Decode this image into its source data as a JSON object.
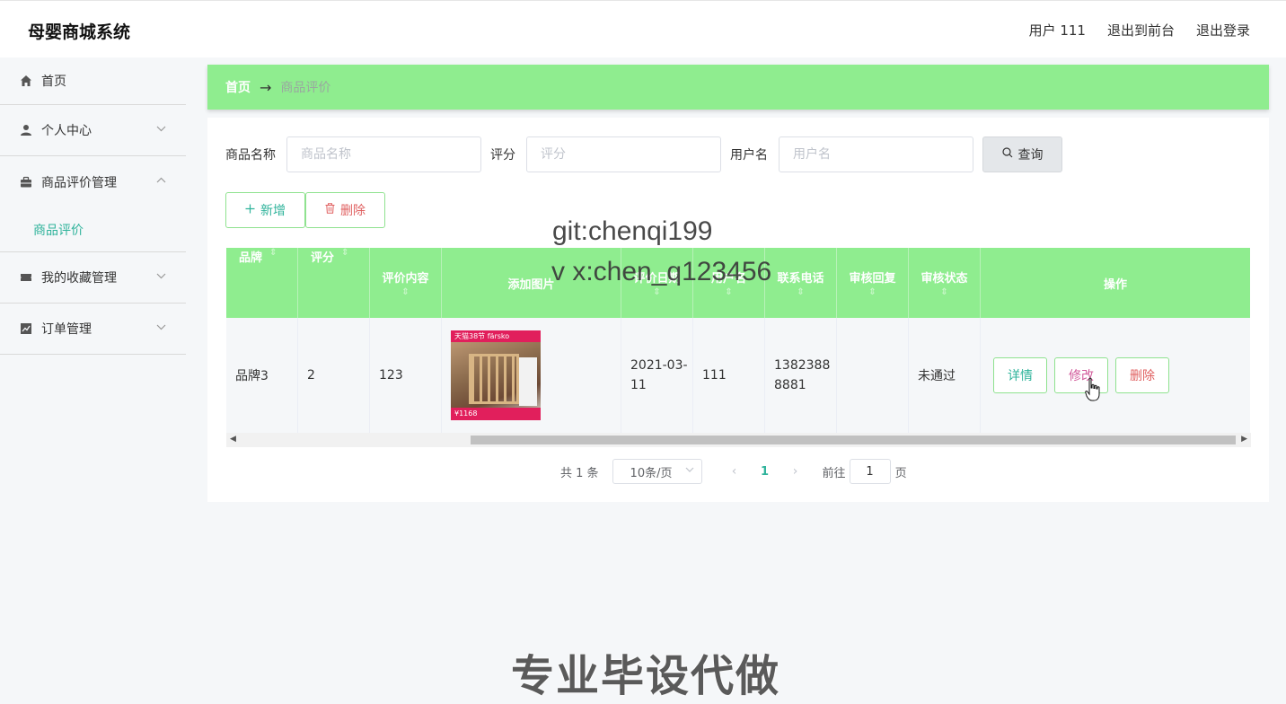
{
  "app": {
    "title": "母婴商城系统"
  },
  "header": {
    "user": "用户 111",
    "to_front": "退出到前台",
    "logout": "退出登录"
  },
  "sidebar": {
    "items": [
      {
        "label": "首页",
        "icon": "home-icon"
      },
      {
        "label": "个人中心",
        "icon": "user-icon"
      },
      {
        "label": "商品评价管理",
        "icon": "briefcase-icon"
      },
      {
        "label": "商品评价",
        "icon": ""
      },
      {
        "label": "我的收藏管理",
        "icon": "ticket-icon"
      },
      {
        "label": "订单管理",
        "icon": "chart-icon"
      }
    ]
  },
  "breadcrumb": {
    "home": "首页",
    "arrow": "→",
    "current": "商品评价"
  },
  "search": {
    "product_label": "商品名称",
    "product_placeholder": "商品名称",
    "product_value": "",
    "score_label": "评分",
    "score_placeholder": "评分",
    "score_value": "",
    "user_label": "用户名",
    "user_placeholder": "用户名",
    "user_value": "",
    "query_label": "查询"
  },
  "actions": {
    "add_label": "新增",
    "delete_label": "删除"
  },
  "table": {
    "headers": [
      "品牌",
      "评分",
      "评价内容",
      "添加图片",
      "评价日期",
      "用户名",
      "联系电话",
      "审核回复",
      "审核状态",
      "操作"
    ],
    "rows": [
      {
        "brand": "品牌3",
        "score": "2",
        "content": "123",
        "image_top_text": "天猫38节 färsko",
        "image_bottom_text": "¥1168",
        "date": "2021-03-11",
        "username": "111",
        "phone": "13823888881",
        "reply": "",
        "status": "未通过",
        "ops": {
          "detail": "详情",
          "edit": "修改",
          "delete": "删除"
        }
      }
    ]
  },
  "pagination": {
    "total": "共 1 条",
    "page_size": "10条/页",
    "prev": "‹",
    "current_page": "1",
    "next": "›",
    "goto_label": "前往",
    "goto_value": "1",
    "page_unit": "页"
  },
  "overlay": {
    "git": "git:chenqi199",
    "vx": "v x:chen_q123456",
    "promo": "专业毕设代做"
  },
  "colors": {
    "accent_green": "#8fed8f",
    "teal_text": "#2fb39b",
    "danger": "#e06060",
    "edit": "#d25b9b"
  }
}
